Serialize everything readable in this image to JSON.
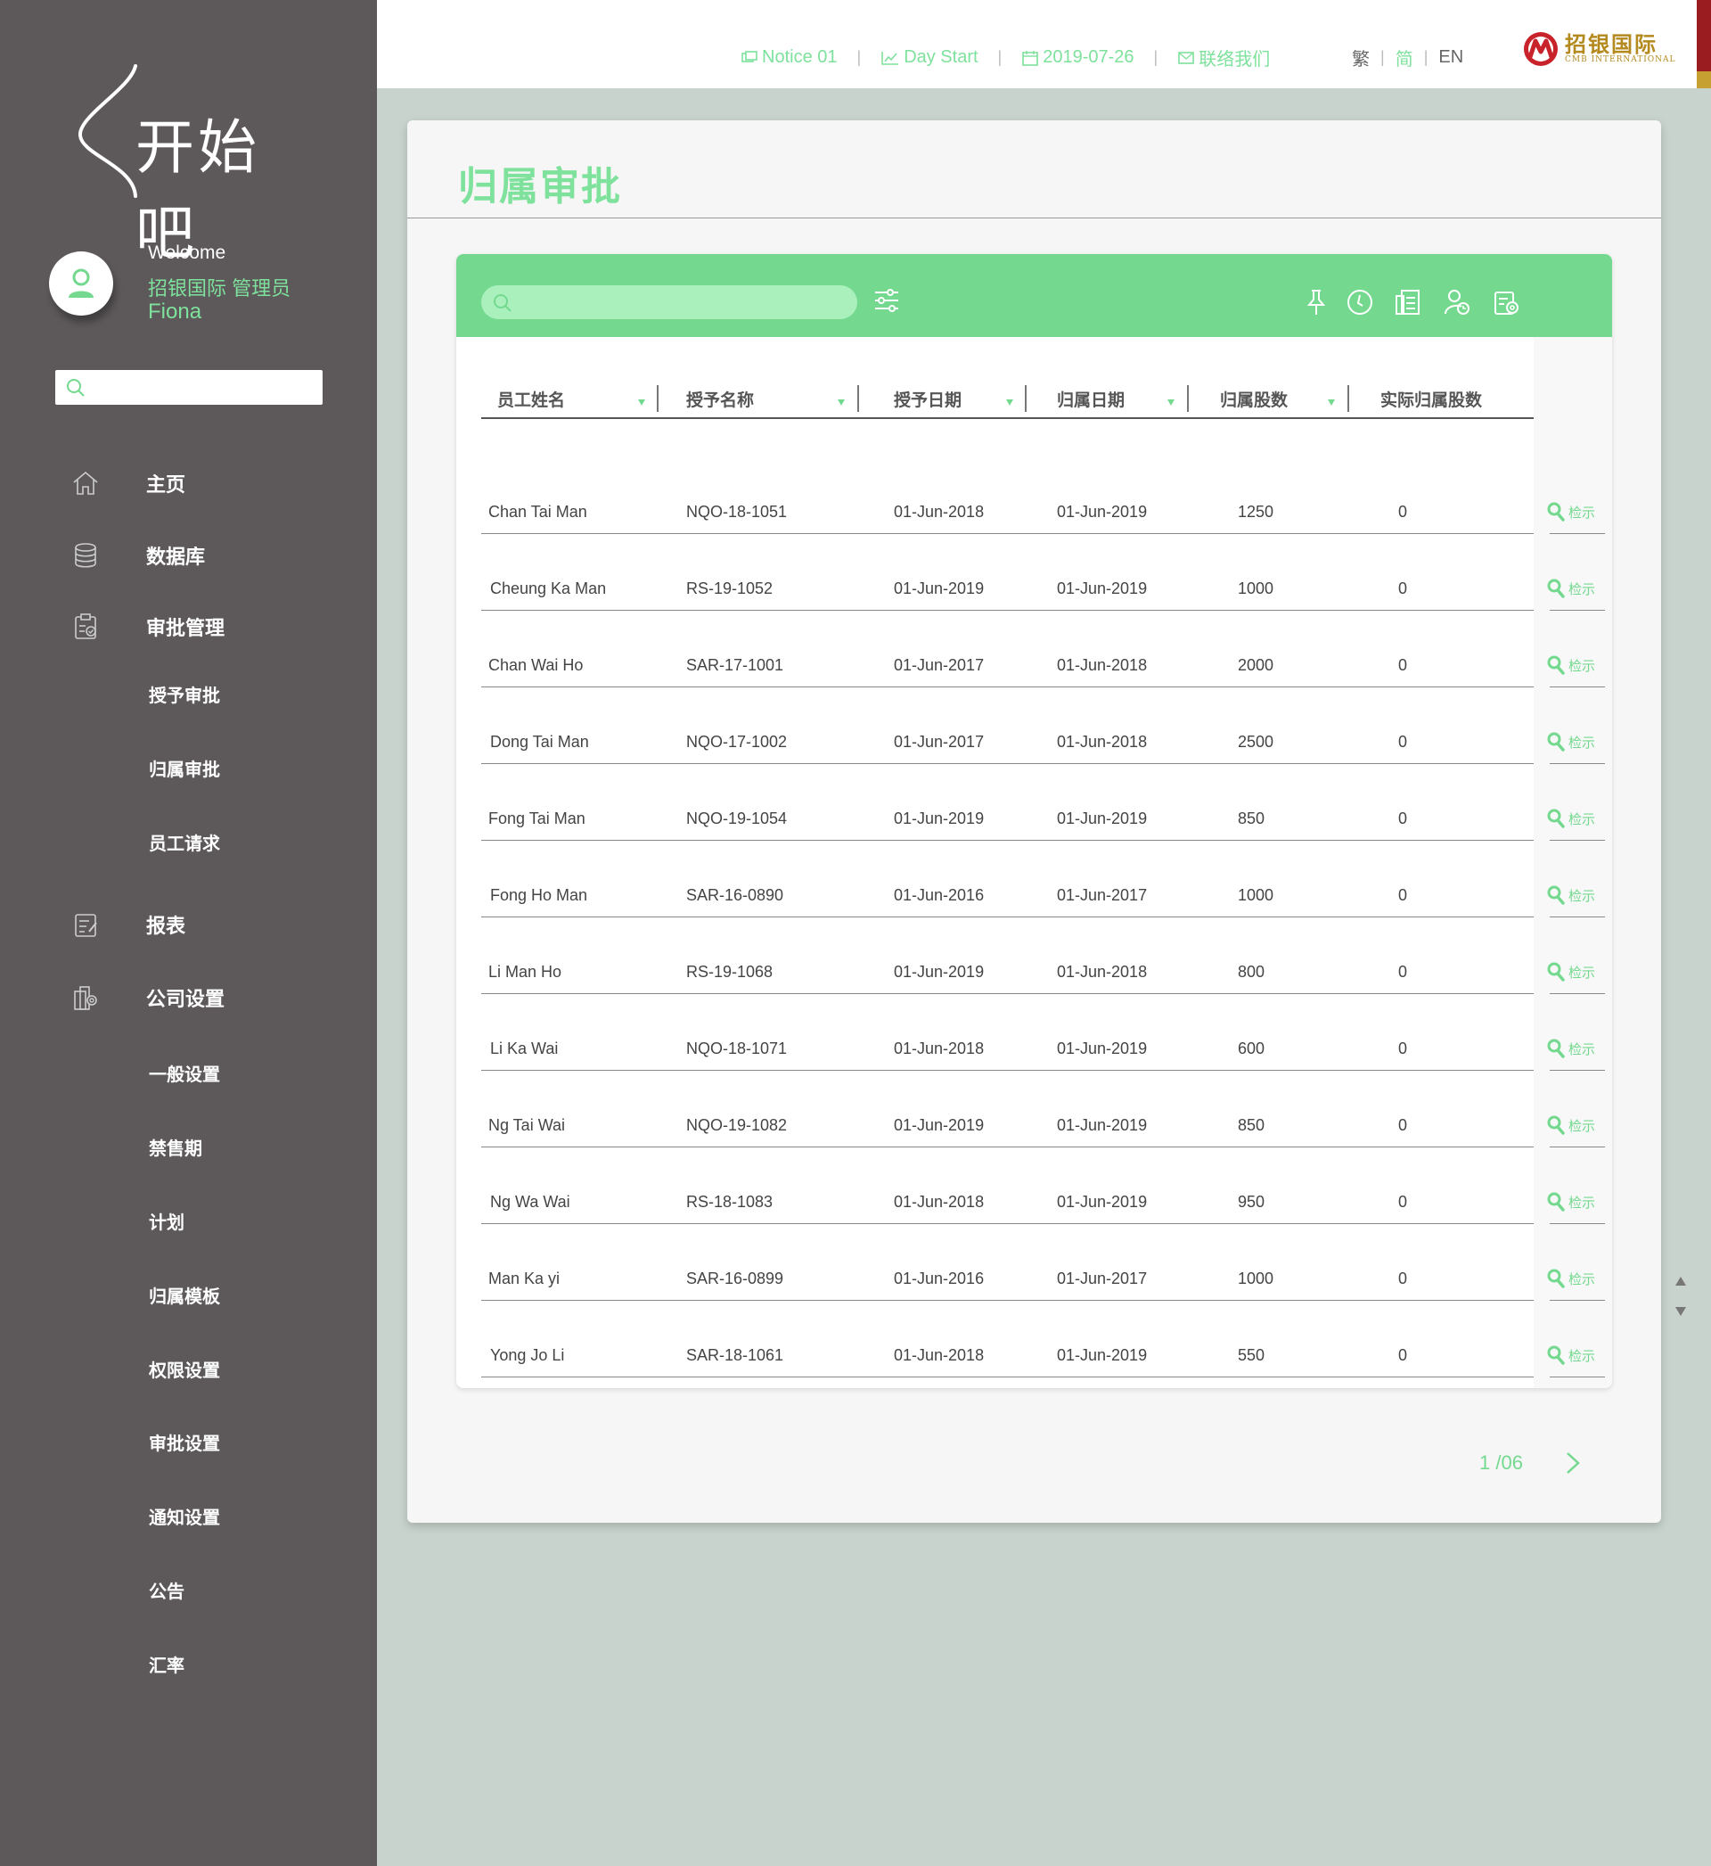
{
  "brand": {
    "logo_text": "开始吧",
    "company_cn": "招银国际",
    "company_en": "CMB INTERNATIONAL"
  },
  "user": {
    "welcome": "Welcome",
    "role": "招银国际 管理员",
    "name": "Fiona"
  },
  "sidebar": {
    "search_placeholder": "",
    "items": [
      {
        "label": "主页",
        "icon": "home-icon"
      },
      {
        "label": "数据库",
        "icon": "database-icon"
      },
      {
        "label": "审批管理",
        "icon": "approval-icon"
      },
      {
        "label": "报表",
        "icon": "report-icon"
      },
      {
        "label": "公司设置",
        "icon": "company-settings-icon"
      }
    ],
    "approval_sub": [
      "授予审批",
      "归属审批",
      "员工请求"
    ],
    "settings_sub": [
      "一般设置",
      "禁售期",
      "计划",
      "归属模板",
      "权限设置",
      "审批设置",
      "通知设置",
      "公告",
      "汇率"
    ]
  },
  "topbar": {
    "notice": "Notice 01",
    "day_start": "Day Start",
    "date": "2019-07-26",
    "contact": "联络我们",
    "lang_trad": "繁",
    "lang_simp": "简",
    "lang_en": "EN"
  },
  "page": {
    "title": "归属审批"
  },
  "table": {
    "search_placeholder": "",
    "columns": [
      "员工姓名",
      "授予名称",
      "授予日期",
      "归属日期",
      "归属股数",
      "实际归属股数"
    ],
    "view_label": "检示",
    "rows": [
      [
        "Chan Tai Man",
        "NQO-18-1051",
        "01-Jun-2018",
        "01-Jun-2019",
        "1250",
        "0"
      ],
      [
        "Cheung Ka Man",
        "RS-19-1052",
        "01-Jun-2019",
        "01-Jun-2019",
        "1000",
        "0"
      ],
      [
        "Chan Wai Ho",
        "SAR-17-1001",
        "01-Jun-2017",
        "01-Jun-2018",
        "2000",
        "0"
      ],
      [
        "Dong Tai Man",
        "NQO-17-1002",
        "01-Jun-2017",
        "01-Jun-2018",
        "2500",
        "0"
      ],
      [
        "Fong Tai Man",
        "NQO-19-1054",
        "01-Jun-2019",
        "01-Jun-2019",
        "850",
        "0"
      ],
      [
        "Fong Ho Man",
        "SAR-16-0890",
        "01-Jun-2016",
        "01-Jun-2017",
        "1000",
        "0"
      ],
      [
        "Li  Man Ho",
        "RS-19-1068",
        "01-Jun-2019",
        "01-Jun-2018",
        "800",
        "0"
      ],
      [
        "Li Ka Wai",
        "NQO-18-1071",
        "01-Jun-2018",
        "01-Jun-2019",
        "600",
        "0"
      ],
      [
        "Ng Tai Wai",
        "NQO-19-1082",
        "01-Jun-2019",
        "01-Jun-2019",
        "850",
        "0"
      ],
      [
        "Ng Wa Wai",
        "RS-18-1083",
        "01-Jun-2018",
        "01-Jun-2019",
        "950",
        "0"
      ],
      [
        "Man Ka yi",
        "SAR-16-0899",
        "01-Jun-2016",
        "01-Jun-2017",
        "1000",
        "0"
      ],
      [
        "Yong Jo Li",
        "SAR-18-1061",
        "01-Jun-2018",
        "01-Jun-2019",
        "550",
        "0"
      ]
    ]
  },
  "pagination": {
    "label": "1 /06"
  },
  "colors": {
    "accent": "#74d98f",
    "accent_light": "#7ee19c",
    "sidebar": "#5d595b",
    "background": "#c9d3cd"
  }
}
